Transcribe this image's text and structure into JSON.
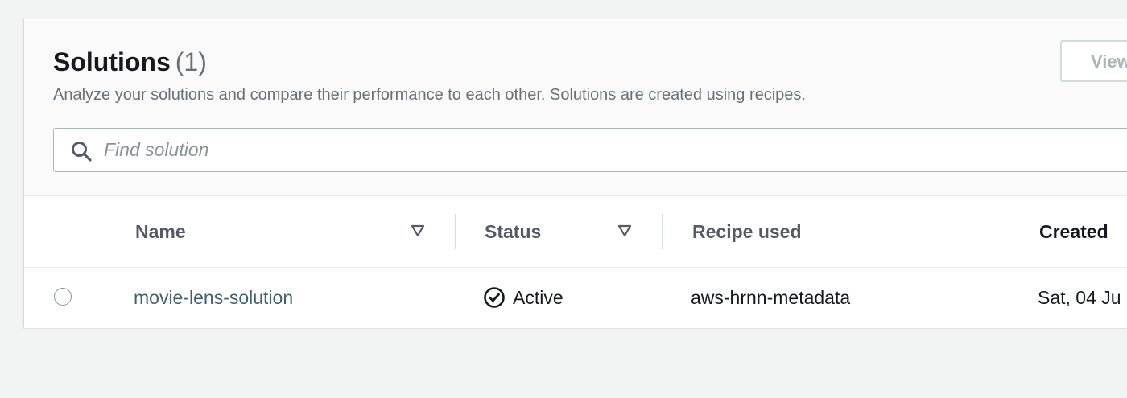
{
  "header": {
    "title": "Solutions",
    "count": "(1)",
    "description": "Analyze your solutions and compare their performance to each other. Solutions are created using recipes.",
    "view_button_label": "View"
  },
  "search": {
    "placeholder": "Find solution",
    "value": "",
    "icon": "search-icon"
  },
  "table": {
    "columns": [
      {
        "label": "Name",
        "sortable": true
      },
      {
        "label": "Status",
        "sortable": true
      },
      {
        "label": "Recipe used",
        "sortable": false
      },
      {
        "label": "Created",
        "sortable": false
      }
    ],
    "rows": [
      {
        "selected": false,
        "name": "movie-lens-solution",
        "status": "Active",
        "status_icon": "check-circle-icon",
        "recipe": "aws-hrnn-metadata",
        "created": "Sat, 04 Ju"
      }
    ]
  },
  "colors": {
    "link": "#44606e",
    "header_text": "#545b64",
    "muted_text": "#687078",
    "panel_border": "#d5dbdb"
  }
}
